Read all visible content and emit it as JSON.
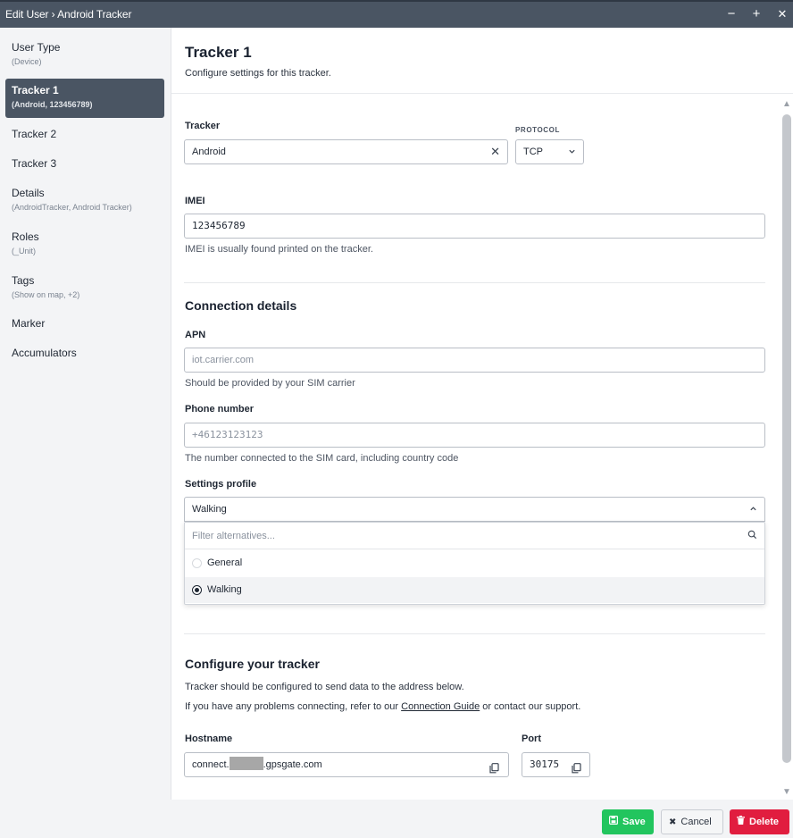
{
  "window": {
    "title": "Edit User › Android Tracker",
    "minimize": "−",
    "maximize": "+",
    "close": "✕"
  },
  "sidebar": {
    "items": [
      {
        "label": "User Type",
        "sub": "(Device)"
      },
      {
        "label": "Tracker 1",
        "sub": "(Android, 123456789)",
        "active": true
      },
      {
        "label": "Tracker 2",
        "sub": ""
      },
      {
        "label": "Tracker 3",
        "sub": ""
      },
      {
        "label": "Details",
        "sub": "(AndroidTracker, Android Tracker)"
      },
      {
        "label": "Roles",
        "sub": "(_Unit)"
      },
      {
        "label": "Tags",
        "sub": "(Show on map, +2)"
      },
      {
        "label": "Marker",
        "sub": ""
      },
      {
        "label": "Accumulators",
        "sub": ""
      }
    ]
  },
  "header": {
    "title": "Tracker 1",
    "description": "Configure settings for this tracker."
  },
  "tracker": {
    "label": "Tracker",
    "value": "Android",
    "clear_icon": "close-icon",
    "protocol_label": "PROTOCOL",
    "protocol_value": "TCP"
  },
  "imei": {
    "label": "IMEI",
    "value": "123456789",
    "help": "IMEI is usually found printed on the tracker."
  },
  "connection": {
    "title": "Connection details",
    "apn_label": "APN",
    "apn_placeholder": "iot.carrier.com",
    "apn_help": "Should be provided by your SIM carrier",
    "phone_label": "Phone number",
    "phone_placeholder": "+46123123123",
    "phone_help": "The number connected to the SIM card, including country code",
    "profile_label": "Settings profile",
    "profile_value": "Walking",
    "filter_placeholder": "Filter alternatives...",
    "options": [
      {
        "label": "General",
        "selected": false
      },
      {
        "label": "Walking",
        "selected": true
      }
    ]
  },
  "configure": {
    "title": "Configure your tracker",
    "line1": "Tracker should be configured to send data to the address below.",
    "line2_prefix": "If you have any problems connecting, refer to our ",
    "line2_link": "Connection Guide",
    "line2_suffix": " or contact our support.",
    "hostname_label": "Hostname",
    "hostname_prefix": "connect.",
    "hostname_suffix": ".gpsgate.com",
    "port_label": "Port",
    "port_value": "30175"
  },
  "footer": {
    "save": "Save",
    "cancel": "Cancel",
    "delete": "Delete"
  },
  "colors": {
    "sidebar_active": "#4a5563",
    "save": "#22c55e",
    "delete": "#e11d3f"
  }
}
